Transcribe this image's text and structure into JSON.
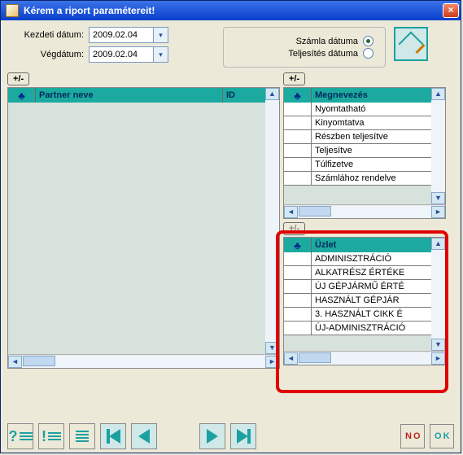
{
  "window": {
    "title": "Kérem a riport paramétereit!"
  },
  "dates": {
    "start_label": "Kezdeti dátum:",
    "start_value": "2009.02.04",
    "end_label": "Végdátum:",
    "end_value": "2009.02.04"
  },
  "radio": {
    "option1_label": "Számla dátuma",
    "option2_label": "Teljesítés dátuma",
    "selected": 1
  },
  "plusminus_label": "+/-",
  "left_table": {
    "col1": "",
    "col2": "Partner neve",
    "col3": "ID"
  },
  "right_table_1": {
    "col1": "",
    "col2": "Megnevezés",
    "rows": [
      "Nyomtatható",
      "Kinyomtatva",
      "Részben teljesítve",
      "Teljesítve",
      "Túlfizetve",
      "Számlához rendelve"
    ]
  },
  "right_table_2": {
    "col1": "",
    "col2": "Üzlet",
    "rows": [
      "ADMINISZTRÁCIÓ",
      "ALKATRÉSZ ÉRTÉKE",
      "ÚJ GÉPJÁRMŰ ÉRTÉ",
      "HASZNÁLT GÉPJÁR",
      "3. HASZNÁLT CIKK É",
      "ÚJ-ADMINISZTRÁCIÓ"
    ]
  },
  "buttons": {
    "no": "N O",
    "ok": "O K"
  },
  "colors": {
    "teal": "#1caaa0",
    "highlight": "#e00000"
  }
}
